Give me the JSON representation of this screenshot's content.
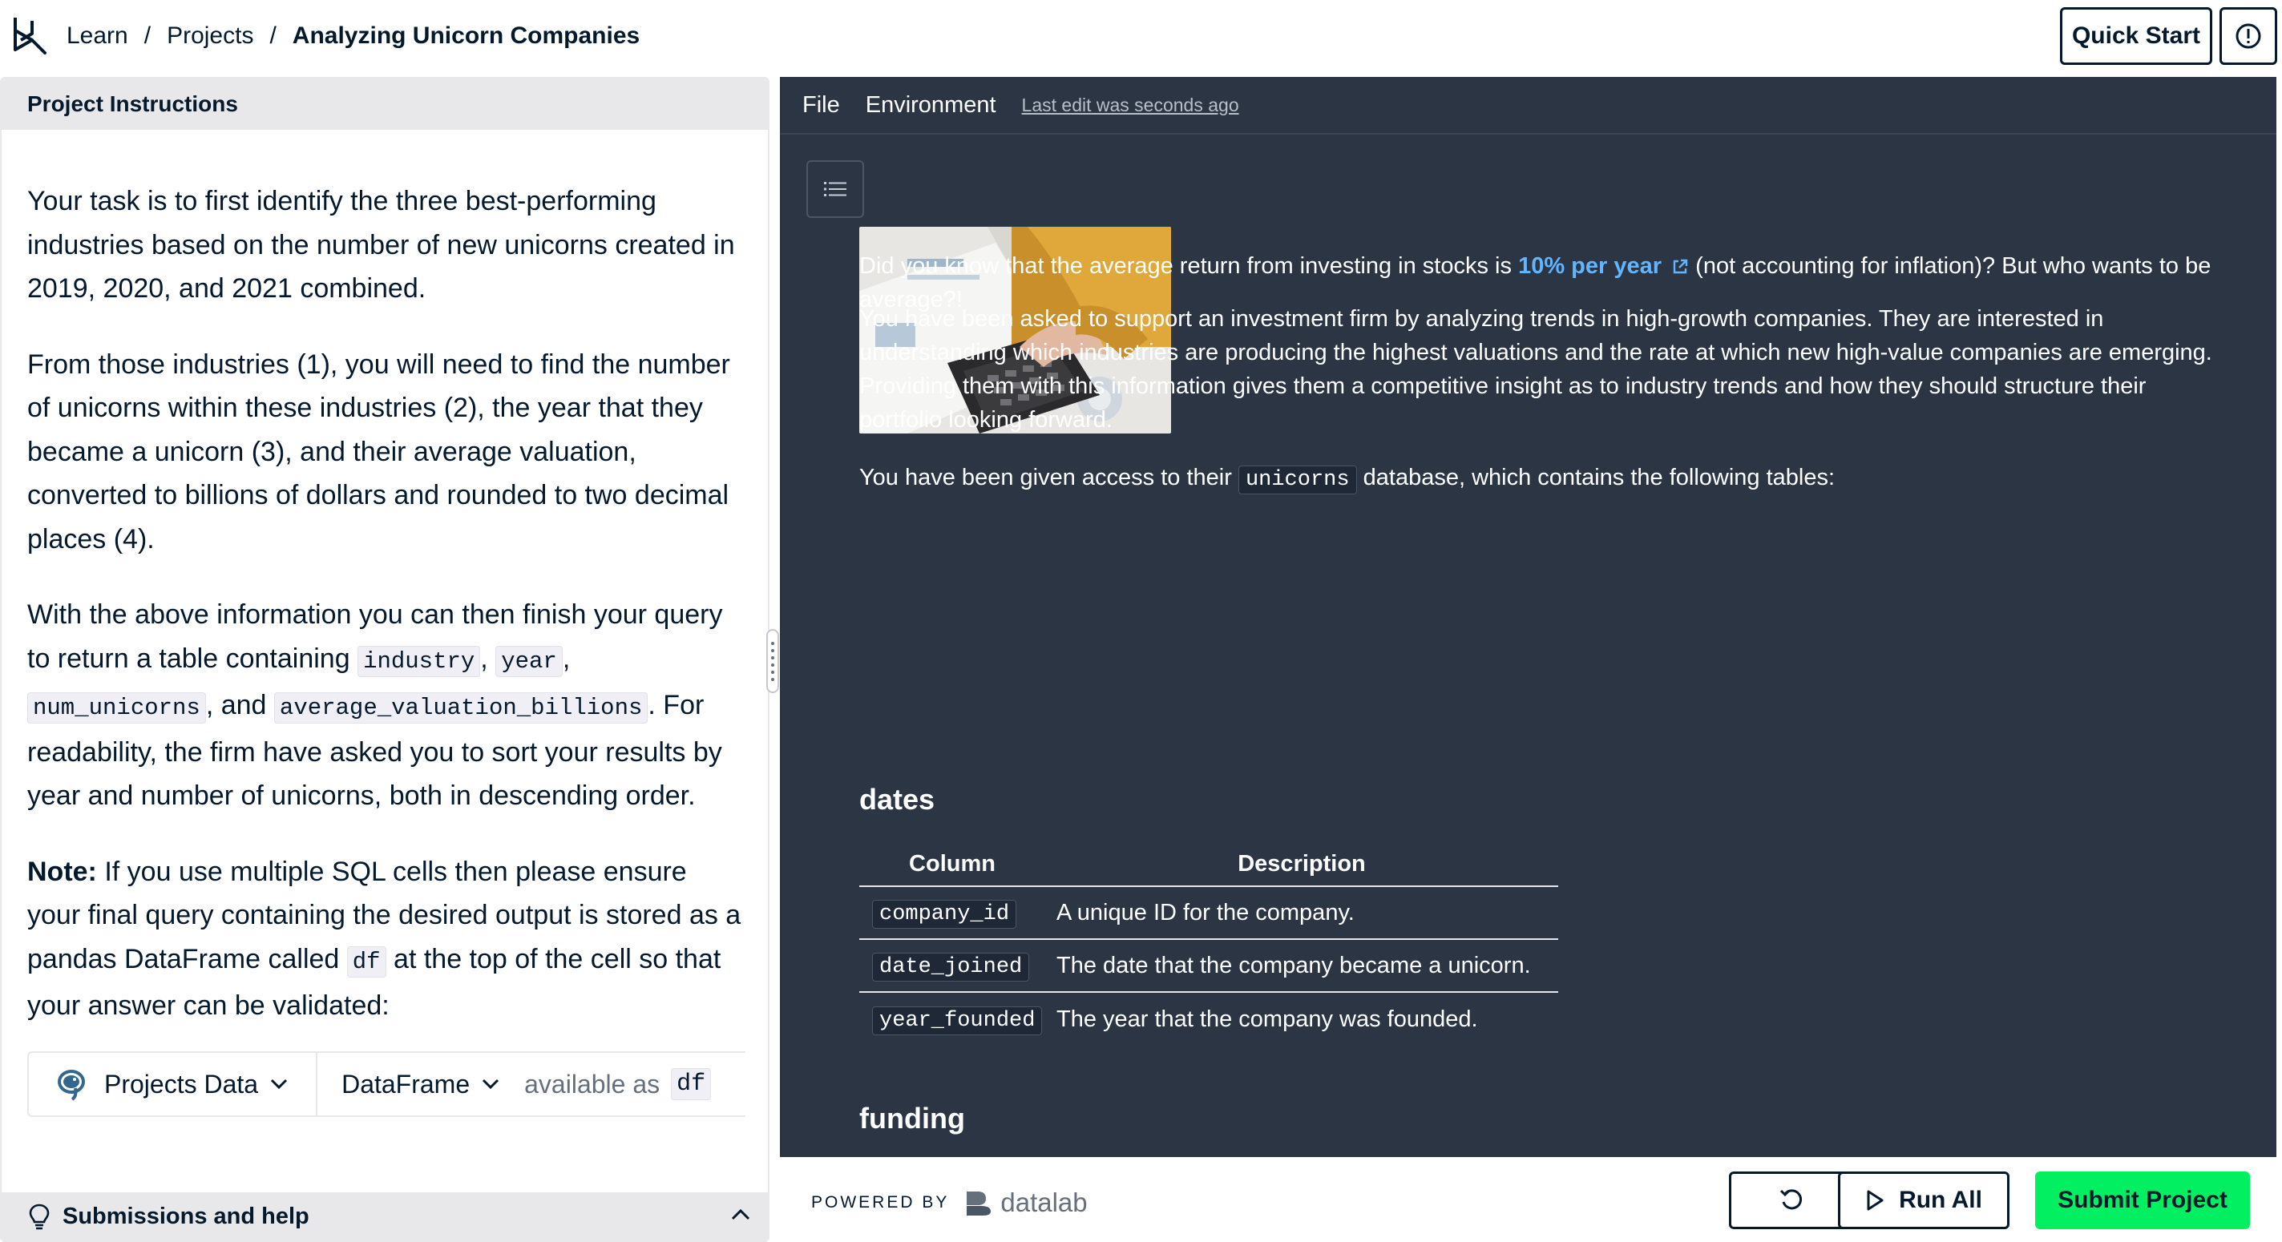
{
  "breadcrumb": {
    "items": [
      "Learn",
      "Projects"
    ],
    "current": "Analyzing Unicorn Companies"
  },
  "header": {
    "quick_start_label": "Quick Start",
    "info_icon": "alert-circle-icon"
  },
  "instructions": {
    "title": "Project Instructions",
    "p1": "Your task is to first identify the three best-performing industries based on the number of new unicorns created in 2019, 2020, and 2021 combined.",
    "p2": "From those industries (1), you will need to find the number of unicorns within these industries (2), the year that they became a unicorn (3), and their average valuation, converted to billions of dollars and rounded to two decimal places (4).",
    "p3_a": "With the above information you can then finish your query to return a table containing",
    "p3_code1": "industry",
    "p3_sep1": ",",
    "p3_code2": "year",
    "p3_sep2": ",",
    "p3_code3": "num_unicorns",
    "p3_and": ", and",
    "p3_code4": "average_valuation_billions",
    "p3_b": ". For readability, the firm have asked you to sort your results by year and number of unicorns, both in descending order.",
    "note_label": "Note:",
    "note_a": "If you use multiple SQL cells then please ensure your final query containing the desired output is stored as a pandas DataFrame called",
    "note_code": "df",
    "note_b": "at the top of the cell so that your answer can be validated:",
    "source_label": "Projects Data",
    "output_label": "DataFrame",
    "available_as": "available as",
    "df_name": "df",
    "footer_label": "Submissions and help"
  },
  "notebook": {
    "menu": [
      "File",
      "Environment"
    ],
    "last_edit": "Last edit was seconds ago",
    "intro_a": "Did you know that the average return from investing in stocks is",
    "intro_link": "10% per year",
    "intro_b": "(not accounting for inflation)? But who wants to be average?!",
    "para2": "You have been asked to support an investment firm by analyzing trends in high-growth companies. They are interested in understanding which industries are producing the highest valuations and the rate at which new high-value companies are emerging. Providing them with this information gives them a competitive insight as to industry trends and how they should structure their portfolio looking forward.",
    "para3_a": "You have been given access to their",
    "para3_code": "unicorns",
    "para3_b": "database, which contains the following tables:",
    "dates_heading": "dates",
    "table_headers": [
      "Column",
      "Description"
    ],
    "dates_rows": [
      {
        "column": "company_id",
        "description": "A unique ID for the company."
      },
      {
        "column": "date_joined",
        "description": "The date that the company became a unicorn."
      },
      {
        "column": "year_founded",
        "description": "The year that the company was founded."
      }
    ],
    "funding_heading": "funding"
  },
  "bottom_bar": {
    "powered_by": "POWERED BY",
    "brand": "datalab",
    "run_all_label": "Run All",
    "submit_label": "Submit Project"
  },
  "colors": {
    "navy": "#05192d",
    "notebook_bg": "#2b3544",
    "link_blue": "#64b5ff",
    "submit_green": "#03ef62"
  }
}
